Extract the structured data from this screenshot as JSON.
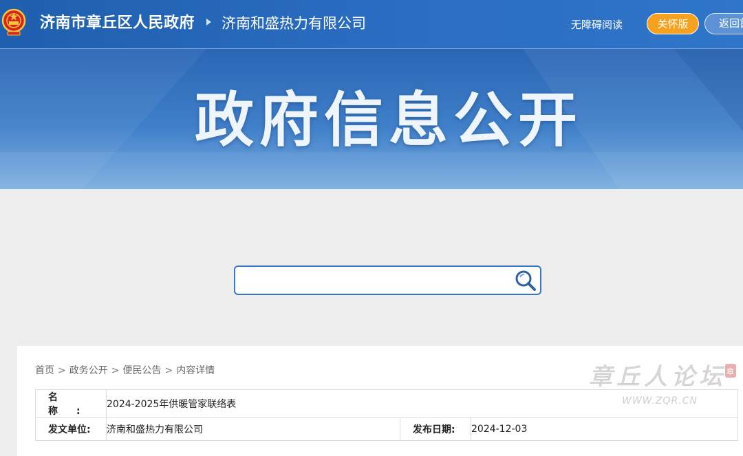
{
  "header": {
    "gov_title": "济南市章丘区人民政府",
    "company_title": "济南和盛热力有限公司",
    "accessibility_label": "无障碍阅读",
    "care_mode_label": "关怀版",
    "back_label": "返回首页"
  },
  "banner": {
    "title": "政府信息公开"
  },
  "search": {
    "value": "",
    "placeholder": ""
  },
  "breadcrumb": [
    "首页",
    "政务公开",
    "便民公告",
    "内容详情"
  ],
  "document": {
    "name_label": "名称:",
    "name_value": "2024-2025年供暖管家联络表",
    "publisher_label": "发文单位:",
    "publisher_value": "济南和盛热力有限公司",
    "date_label": "发布日期:",
    "date_value": "2024-12-03"
  },
  "watermark": {
    "text": "章丘人论坛",
    "url": "WWW.ZQR.CN"
  },
  "colors": {
    "header_blue": "#2666b8",
    "care_orange": "#f7a21e",
    "search_border": "#3b78c4"
  },
  "icons": {
    "emblem": "national-emblem-icon",
    "search": "magnifier-icon",
    "breadcrumb_arrow": "triangle-right-icon"
  }
}
